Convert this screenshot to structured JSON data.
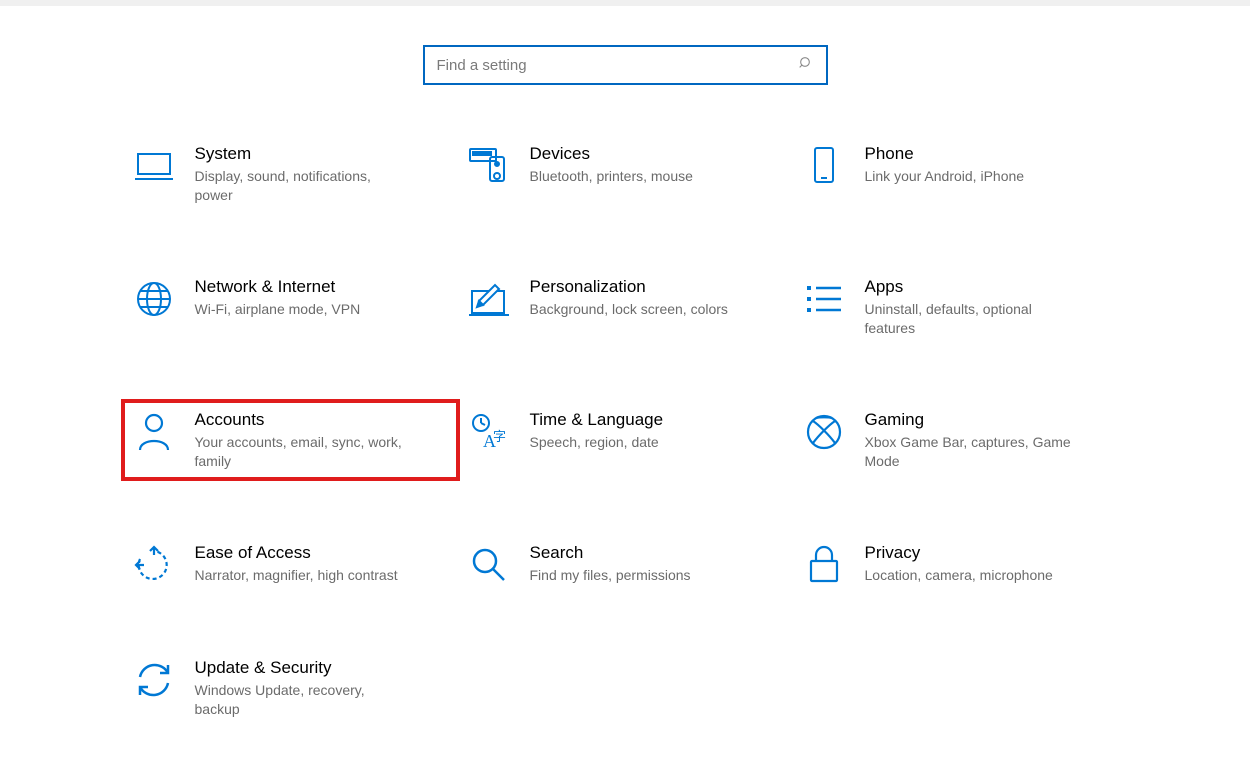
{
  "search": {
    "placeholder": "Find a setting"
  },
  "tiles": [
    {
      "title": "System",
      "desc": "Display, sound, notifications, power"
    },
    {
      "title": "Devices",
      "desc": "Bluetooth, printers, mouse"
    },
    {
      "title": "Phone",
      "desc": "Link your Android, iPhone"
    },
    {
      "title": "Network & Internet",
      "desc": "Wi-Fi, airplane mode, VPN"
    },
    {
      "title": "Personalization",
      "desc": "Background, lock screen, colors"
    },
    {
      "title": "Apps",
      "desc": "Uninstall, defaults, optional features"
    },
    {
      "title": "Accounts",
      "desc": "Your accounts, email, sync, work, family"
    },
    {
      "title": "Time & Language",
      "desc": "Speech, region, date"
    },
    {
      "title": "Gaming",
      "desc": "Xbox Game Bar, captures, Game Mode"
    },
    {
      "title": "Ease of Access",
      "desc": "Narrator, magnifier, high contrast"
    },
    {
      "title": "Search",
      "desc": "Find my files, permissions"
    },
    {
      "title": "Privacy",
      "desc": "Location, camera, microphone"
    },
    {
      "title": "Update & Security",
      "desc": "Windows Update, recovery, backup"
    }
  ]
}
